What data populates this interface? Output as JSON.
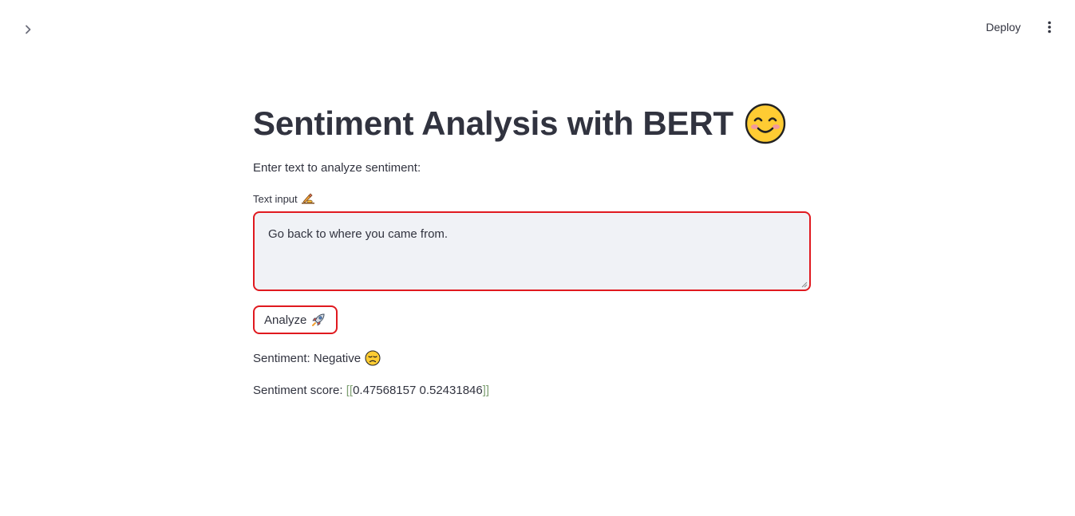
{
  "header": {
    "deploy_label": "Deploy"
  },
  "main": {
    "title": "Sentiment Analysis with BERT",
    "title_icon": "smiling-face-emoji",
    "intro": "Enter text to analyze sentiment:",
    "input": {
      "label": "Text input",
      "label_icon": "writing-hand-emoji",
      "value": "Go back to where you came from."
    },
    "analyze_button": {
      "label": "Analyze",
      "icon": "rocket-emoji"
    },
    "result": {
      "sentiment_text": "Sentiment: Negative",
      "sentiment_icon": "disappointed-face-emoji",
      "score_prefix": "Sentiment score: ",
      "score_open": "[[",
      "score_values": "0.47568157 0.52431846",
      "score_close": "]]"
    }
  },
  "colors": {
    "accent_border": "#e0191f",
    "input_bg": "#f0f2f6",
    "text": "#31333f",
    "bracket": "#7fa173"
  }
}
